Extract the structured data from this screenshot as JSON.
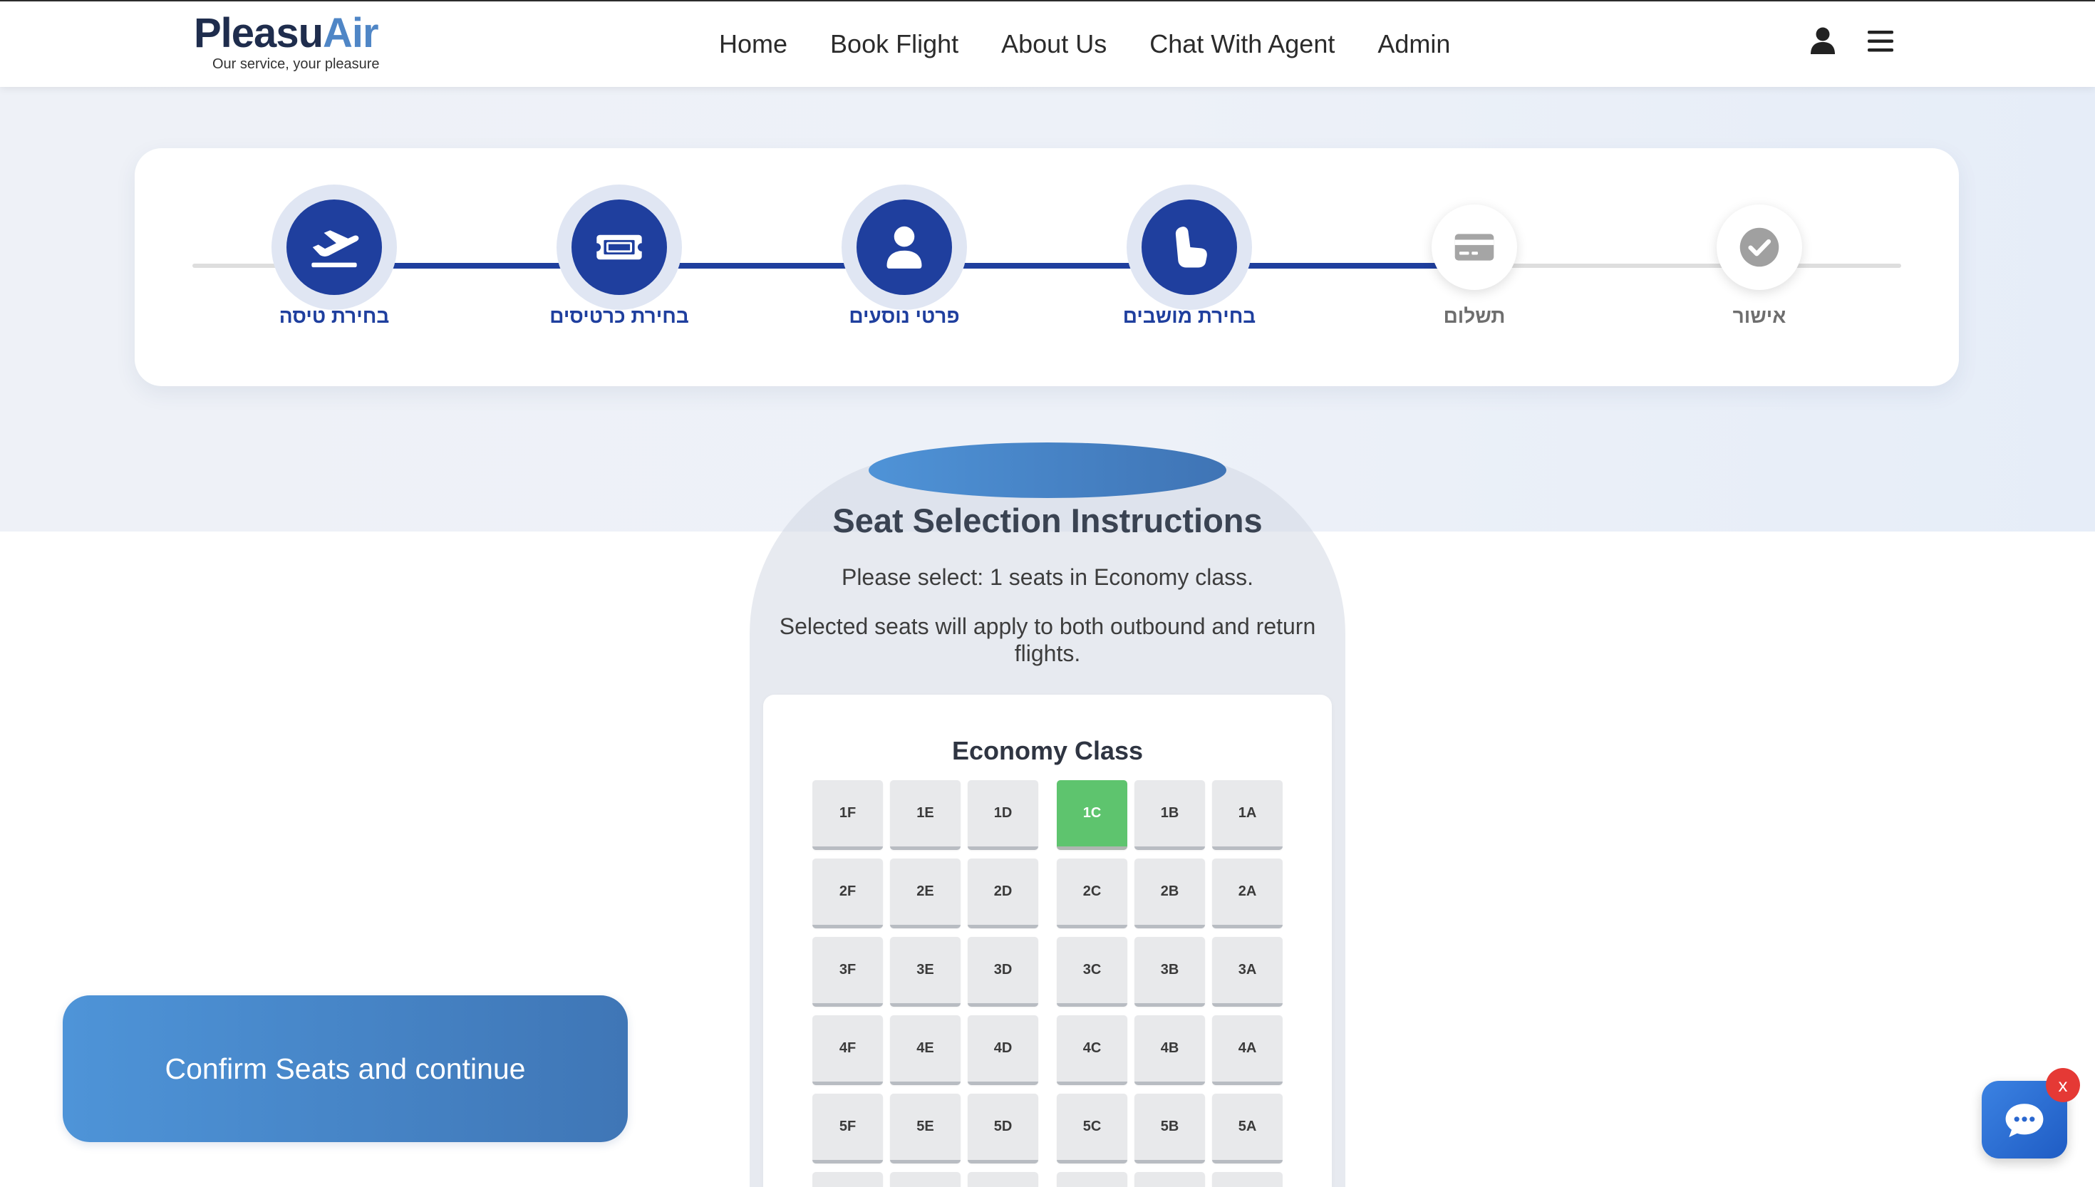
{
  "brand": {
    "name_primary": "Pleasu",
    "name_accent": "Air",
    "tagline": "Our service, your pleasure"
  },
  "nav": {
    "items": [
      {
        "label": "Home"
      },
      {
        "label": "Book Flight"
      },
      {
        "label": "About Us"
      },
      {
        "label": "Chat With Agent"
      },
      {
        "label": "Admin"
      }
    ]
  },
  "header_actions": {
    "account_icon": "user-icon",
    "menu_icon": "hamburger-menu-icon"
  },
  "stepper": {
    "progress_fraction": 0.8,
    "steps": [
      {
        "label": "בחירת טיסה",
        "icon": "plane-departure-icon",
        "status": "completed"
      },
      {
        "label": "בחירת כרטיסים",
        "icon": "ticket-icon",
        "status": "completed"
      },
      {
        "label": "פרטי נוסעים",
        "icon": "user-icon",
        "status": "completed"
      },
      {
        "label": "בחירת מושבים",
        "icon": "seat-icon",
        "status": "current"
      },
      {
        "label": "תשלום",
        "icon": "credit-card-icon",
        "status": "pending"
      },
      {
        "label": "אישור",
        "icon": "check-circle-icon",
        "status": "pending"
      }
    ]
  },
  "instructions": {
    "title": "Seat Selection Instructions",
    "seat_requirement": "Please select: 1 seats in Economy class.",
    "note": "Selected seats will apply to both outbound and return flights."
  },
  "seat_map": {
    "cabin_label": "Economy Class",
    "rows": [
      {
        "left": [
          "1F",
          "1E",
          "1D"
        ],
        "right": [
          "1C",
          "1B",
          "1A"
        ]
      },
      {
        "left": [
          "2F",
          "2E",
          "2D"
        ],
        "right": [
          "2C",
          "2B",
          "2A"
        ]
      },
      {
        "left": [
          "3F",
          "3E",
          "3D"
        ],
        "right": [
          "3C",
          "3B",
          "3A"
        ]
      },
      {
        "left": [
          "4F",
          "4E",
          "4D"
        ],
        "right": [
          "4C",
          "4B",
          "4A"
        ]
      },
      {
        "left": [
          "5F",
          "5E",
          "5D"
        ],
        "right": [
          "5C",
          "5B",
          "5A"
        ]
      }
    ],
    "selected_seats": [
      "1C"
    ]
  },
  "confirm_button": {
    "label": "Confirm Seats and continue"
  },
  "chat_widget": {
    "icon": "chat-bubble-icon",
    "close_label": "x"
  },
  "colors": {
    "brand_navy": "#1f2d4d",
    "brand_accent": "#4f86c6",
    "step_active": "#1f3f9e",
    "step_active_halo": "#e0e6f3",
    "step_inactive": "#a3a3a3",
    "seat_selected": "#5ec46e",
    "seat_available": "#e8e9eb",
    "button_primary": "#4a8dd3",
    "chat_widget": "#2f70da",
    "close_badge": "#e53935"
  }
}
